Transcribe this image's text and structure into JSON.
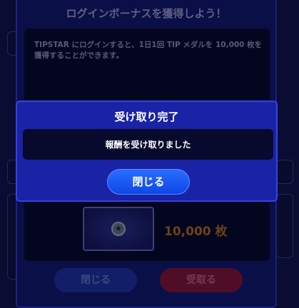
{
  "main_dialog": {
    "title": "ログインボーナスを獲得しよう！",
    "description": "TIPSTAR にログインすると、1日1回 TIP メダルを 10,000 枚を獲得することができます。",
    "reward": {
      "icon": "star-medal-icon",
      "amount": "10,000 枚"
    },
    "close_label": "閉じる",
    "receive_label": "受取る"
  },
  "modal": {
    "title": "受け取り完了",
    "message": "報酬を受け取りました",
    "close_label": "閉じる"
  },
  "colors": {
    "panel": "#121869",
    "modal": "#1a22a6",
    "primary_button": "#1454ff",
    "receive_button": "#7a1436",
    "reward_amount": "#a8661a"
  }
}
